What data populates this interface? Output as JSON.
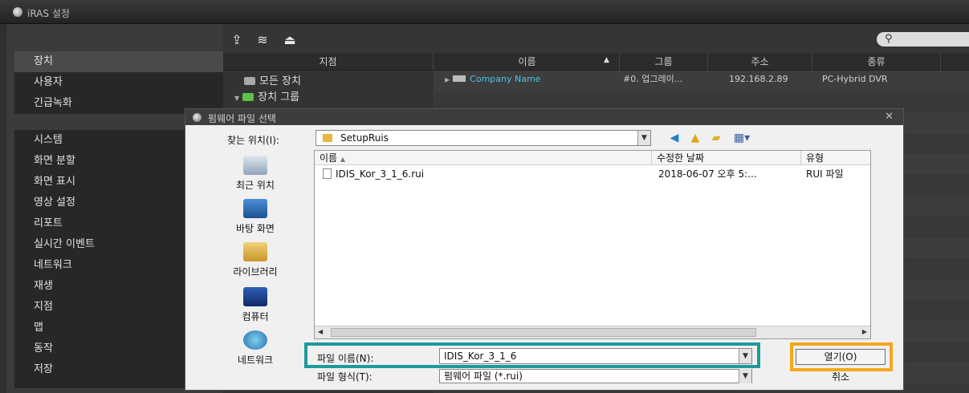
{
  "window": {
    "title": "iRAS 설정"
  },
  "sidebar": {
    "group1": [
      "장치",
      "사용자",
      "긴급녹화"
    ],
    "group2": [
      "시스템",
      "화면 분할",
      "화면 표시",
      "영상 설정",
      "리포트",
      "실시간 이벤트",
      "네트워크",
      "재생",
      "지점",
      "맵",
      "동작",
      "저장"
    ]
  },
  "grid": {
    "columns": {
      "site": "지점",
      "name": "이름",
      "group": "그룹",
      "address": "주소",
      "type": "종류"
    },
    "tree": [
      "모든 장치",
      "장치 그룹"
    ],
    "device": {
      "name": "Company Name",
      "group": "#0. 업그레이...",
      "address": "192.168.2.89",
      "type": "PC-Hybrid DVR"
    }
  },
  "dialog": {
    "title": "펌웨어 파일 선택",
    "close": "✕",
    "look_in_label": "찾는 위치(I):",
    "look_in_value": "SetupRuis",
    "places": [
      "최근 위치",
      "바탕 화면",
      "라이브러리",
      "컴퓨터",
      "네트워크"
    ],
    "columns": {
      "name": "이름",
      "date": "수정한 날짜",
      "type": "유형"
    },
    "file": {
      "name": "IDIS_Kor_3_1_6.rui",
      "date": "2018-06-07 오후 5:...",
      "type": "RUI 파일"
    },
    "filename_label": "파일 이름(N):",
    "filename_value": "IDIS_Kor_3_1_6",
    "filetype_label": "파일 형식(T):",
    "filetype_value": "펌웨어 파일 (*.rui)",
    "open_button": "열기(O)",
    "cancel_button": "취소"
  },
  "colors": {
    "highlight_teal": "#1e9a9c",
    "highlight_orange": "#f2a81d",
    "link": "#4fc3e8"
  }
}
